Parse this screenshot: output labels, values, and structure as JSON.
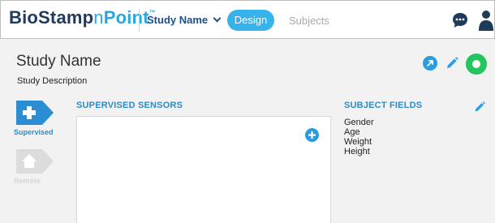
{
  "topbar": {
    "logo_part1": "BioStamp",
    "logo_part2": "n",
    "logo_part3": "Point",
    "logo_tm": "™",
    "study_select": "Study Name",
    "tabs": [
      {
        "label": "Design",
        "active": true
      },
      {
        "label": "Subjects",
        "active": false
      }
    ],
    "icons": [
      "chat-icon",
      "user-icon"
    ]
  },
  "study": {
    "name": "Study Name",
    "description": "Study Description",
    "actions": [
      "share-icon",
      "edit-icon",
      "status-toggle-icon"
    ],
    "status_color": "#22c55e"
  },
  "nav": [
    {
      "label": "Supervised",
      "icon": "plus-icon",
      "active": true
    },
    {
      "label": "Remote",
      "icon": "home-icon",
      "active": false
    }
  ],
  "sensors": {
    "title": "SUPERVISED SENSORS",
    "add_icon": "add-circle-icon"
  },
  "subject_fields": {
    "title": "SUBJECT FIELDS",
    "items": [
      "Gender",
      "Age",
      "Weight",
      "Height"
    ]
  },
  "colors": {
    "accent": "#2a8bc9",
    "brand_dark": "#1f3b5c",
    "tab_active": "#36b3ea"
  }
}
